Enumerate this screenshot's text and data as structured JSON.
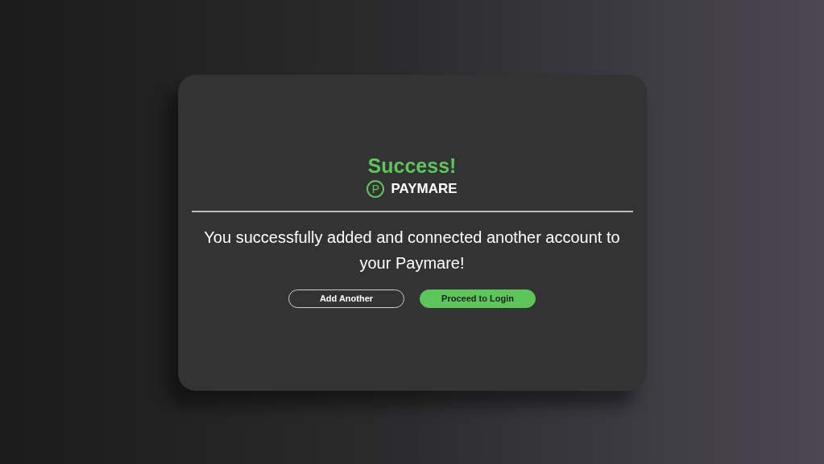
{
  "title": "Success!",
  "brand": {
    "mark": "P",
    "name": "PAYMARE"
  },
  "message": "You successfully added and connected another account to your Paymare!",
  "buttons": [
    {
      "label": "Add Another",
      "kind": "outline"
    },
    {
      "label": "Proceed to Login",
      "kind": "filled"
    }
  ]
}
